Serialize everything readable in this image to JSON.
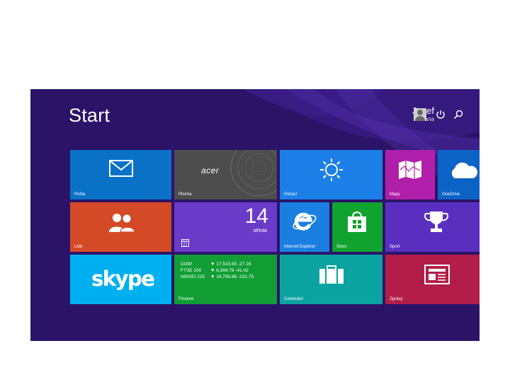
{
  "start": {
    "title": "Start"
  },
  "user": {
    "name": "Josef",
    "sub": "Zuzana"
  },
  "icons": {
    "power": "power-icon",
    "search": "search-icon"
  },
  "tiles": {
    "mail": {
      "label": "Pošta",
      "color": "#0a72c6",
      "icon": "mail-icon"
    },
    "photos": {
      "label": "Plocha",
      "color": "#4d4d4d",
      "icon": "acer-desktop",
      "brand": "acer"
    },
    "weather": {
      "label": "Počasí",
      "color": "#1c7fe8",
      "icon": "sun-icon"
    },
    "maps": {
      "label": "Mapy",
      "color": "#b01faa",
      "icon": "map-icon"
    },
    "onedrive": {
      "label": "OneDrive",
      "color": "#0b63c6",
      "icon": "cloud-icon"
    },
    "people": {
      "label": "Lidé",
      "color": "#d44a26",
      "icon": "people-icon"
    },
    "calendar": {
      "day_number": "14",
      "day_name": "středa",
      "color": "#6a3ac8",
      "icon": "calendar-icon"
    },
    "ie": {
      "label": "Internet Explorer",
      "color": "#1a7fe0",
      "icon": "ie-icon"
    },
    "store": {
      "label": "Store",
      "color": "#10a330",
      "icon": "store-icon"
    },
    "sport": {
      "label": "Sport",
      "color": "#5a2fc0",
      "icon": "trophy-icon"
    },
    "skype": {
      "brand": "skype",
      "color": "#00aff0",
      "icon": "skype-logo"
    },
    "finance": {
      "label": "Finance",
      "color": "#119f35",
      "rows": [
        {
          "name": "DOW",
          "value": "▼ 17,515.55 -27.16"
        },
        {
          "name": "FTSE 100",
          "value": "▼ 6,394.78 -41.42"
        },
        {
          "name": "NIKKEI 225",
          "value": "▼ 16,795.96 -231.75"
        }
      ]
    },
    "travel": {
      "label": "Cestování",
      "color": "#0aa3a0",
      "icon": "briefcase-icon"
    },
    "news": {
      "label": "Zprávy",
      "color": "#b21e49",
      "icon": "news-icon"
    }
  }
}
